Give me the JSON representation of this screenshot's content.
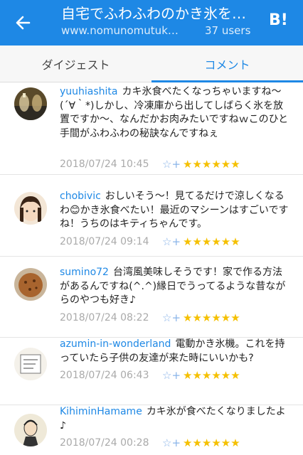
{
  "header": {
    "title": "自宅でふわふわのかき氷を…",
    "url": "www.nomunomutuk…",
    "users": "37 users",
    "hb_label": "B!"
  },
  "tabs": [
    {
      "label": "ダイジェスト",
      "active": false
    },
    {
      "label": "コメント",
      "active": true
    }
  ],
  "comments": [
    {
      "user": "yuuhiashita",
      "text": "カキ氷食べたくなっちゃいますね〜(´∀｀*)しかし、冷凍庫から出してしばらく氷を放置ですか〜、なんだかお肉みたいですねｗこのひと手間がふわふわの秘訣なんですねぇ",
      "timestamp": "2018/07/24 10:45",
      "add_star": "☆+",
      "stars": "★★★★★★"
    },
    {
      "user": "chobivic",
      "text": "おしいそう〜！見てるだけで涼しくなるわ😊かき氷食べたい！最近のマシーンはすごいですね！うちのはキティちゃんです。",
      "timestamp": "2018/07/24 09:14",
      "add_star": "☆+",
      "stars": "★★★★★★"
    },
    {
      "user": "sumino72",
      "text": "台湾風美味しそうです！家で作る方法があるんですね(^.^)縁日でうってるような昔ながらのやつも好き♪",
      "timestamp": "2018/07/24 08:22",
      "add_star": "☆+",
      "stars": "★★★★★★"
    },
    {
      "user": "azumin-in-wonderland",
      "text": "電動かき氷機。これを持っていたら子供の友達が来た時にいいかも?",
      "timestamp": "2018/07/24 06:43",
      "add_star": "☆+",
      "stars": "★★★★★★"
    },
    {
      "user": "KihiminHamame",
      "text": "カキ氷が食べたくなりましたよ♪",
      "timestamp": "2018/07/24 00:28",
      "add_star": "☆+",
      "stars": "★★★★★★"
    }
  ],
  "colors": {
    "accent": "#1e88e5",
    "star": "#f5c000",
    "meta": "#aaaaaa"
  }
}
